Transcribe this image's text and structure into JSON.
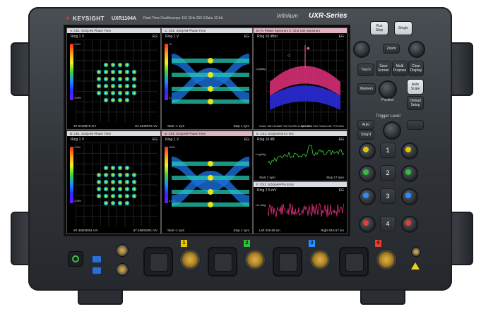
{
  "header": {
    "brand": "KEYSIGHT",
    "model": "UXR1104A",
    "spec": "Real-Time Oscilloscope   110 GHz   256 GSa/s   10-bit",
    "product_family": "Infiniium",
    "series": "UXR-Series"
  },
  "panels": [
    {
      "title": "A: Ch1: SOQAM Phase Time",
      "scale": "Ring 1  V",
      "eg": "EG",
      "pct_top": "100%",
      "pct_bot": "3.45%",
      "foot_left": "-87.2449876 mV",
      "foot_right": "87.2449876 mV"
    },
    {
      "title": "C: Ch1: SOQAM Phase Time",
      "scale": "Ring 1  V",
      "eg": "EG",
      "pct_top": "100%",
      "pct_bot": "3.45%",
      "foot_left": "Start -1   sym",
      "foot_right": "Stop 1   sym"
    },
    {
      "title": "B: Fc Power Spectrum   C: Ch2 Unit Spectrum",
      "scale": "Ring 10 dBm",
      "eg": "EG",
      "ylabel": "LogMag",
      "foot_left": "Center 165.4144489 THz  Res BW 44.54?? kHz",
      "foot_right": "Span 82.5 GHz  TimeLen 65.7?75 nSec"
    },
    {
      "title": "B: Ch1: SOQAM Phase Time",
      "scale": "Ring 1  V",
      "eg": "EG",
      "pct_top": "100%",
      "pct_bot": "3.45%",
      "foot_left": "-87.46803091 mV",
      "foot_right": "87.46803091 mV"
    },
    {
      "title": "B: Ch3: SOQAM Phase Time",
      "scale": "Ring 1  V",
      "eg": "EG",
      "pct_top": "100%",
      "pct_bot": "3.45%",
      "foot_left": "Start -1   sym",
      "foot_right": "Stop 1   sym"
    },
    {
      "title": "E: Ch1: SOQAM Error Vec",
      "scale": "Ring 10  dB",
      "eg": "EG",
      "ylabel": "LogMag",
      "foot_left": "Start 1   sym",
      "foot_right": "Stop 17   sym"
    },
    {
      "title": "F: Ch1: SOQAM Phs Error",
      "scale": "Ring 2.5 mV",
      "eg": "EG",
      "ylabel": "Lin Mag",
      "foot_left": "Left 426.65   sm",
      "foot_right": "Right 916.57   sm"
    }
  ],
  "front_panel": {
    "run_stop": "Run\nStop",
    "single": "Single",
    "zoom": "Zoom",
    "touch": "Touch",
    "save_screen": "Save\nScreen",
    "multi_purpose": "Multi\nPurpose",
    "clear_display": "Clear\nDisplay",
    "markers": "Markers",
    "auto_scale": "Auto\nScale",
    "position": "Position",
    "default_setup": "Default\nSetup",
    "trigger_level": "Trigger Level",
    "auto": "Auto",
    "stop_disp": "Sing'd",
    "ch1": "1",
    "ch2": "2",
    "ch3": "3",
    "ch4": "4"
  },
  "bottom": {
    "ch_tags": [
      "1",
      "2",
      "3",
      "4"
    ],
    "ch_colors": [
      "#e6c400",
      "#2fbf3a",
      "#2a8cff",
      "#e2402e"
    ]
  },
  "colors": {
    "ch1": "#e6c400",
    "ch2": "#2fbf3a",
    "ch3": "#2a8cff",
    "ch4": "#e2402e",
    "power": "#38c44a"
  }
}
